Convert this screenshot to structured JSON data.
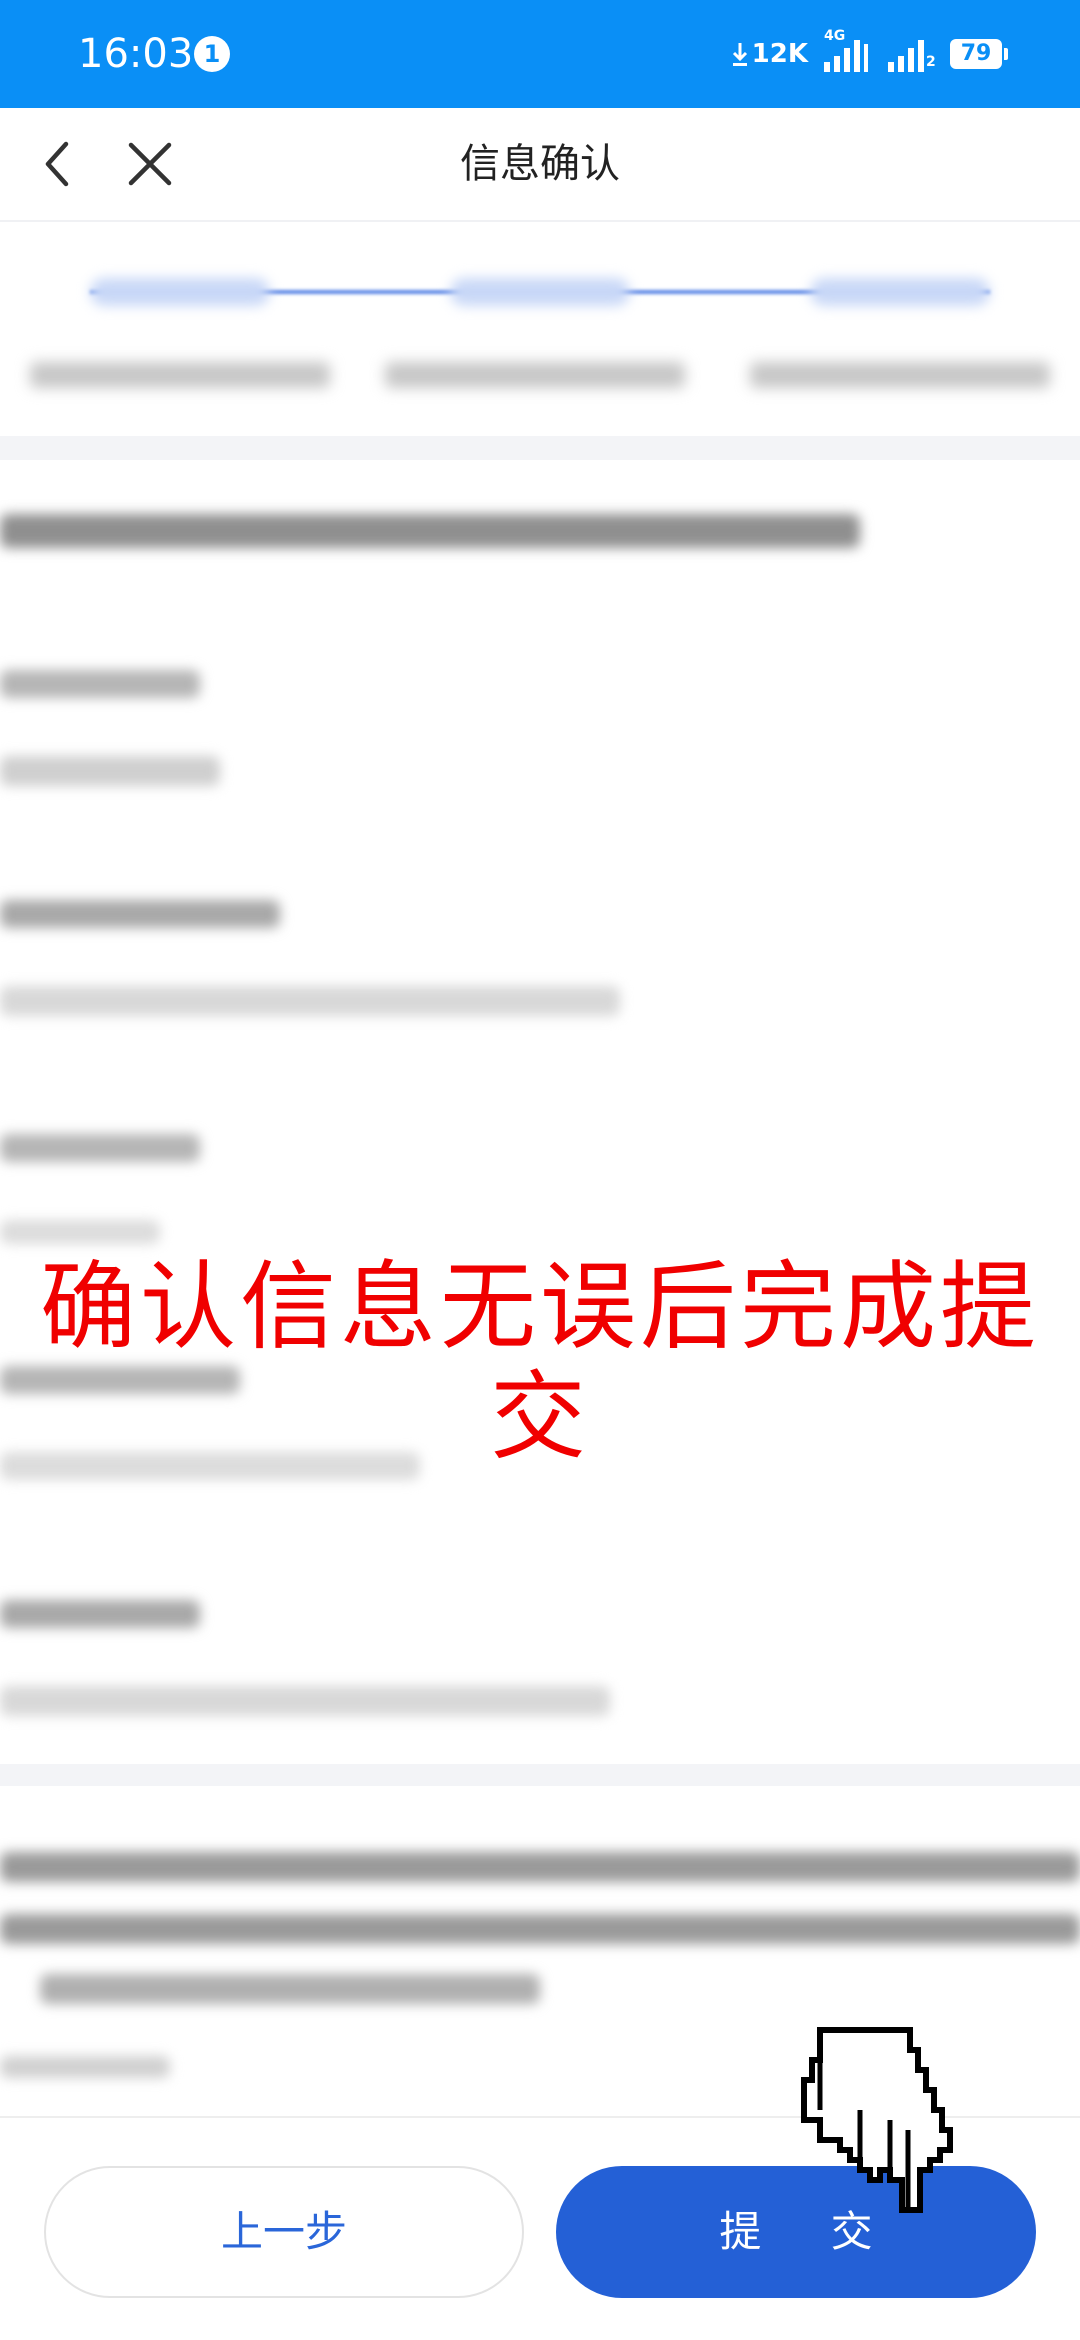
{
  "status_bar": {
    "time": "16:03",
    "notification_count": "1",
    "net_speed": "12K",
    "network_type": "4G",
    "sim2_label": "2",
    "battery": "79",
    "background": "#0a8ff6"
  },
  "header": {
    "title": "信息确认"
  },
  "overlay": {
    "annotation": "确认信息无误后完成提交",
    "color": "#f00000"
  },
  "footer": {
    "prev_label": "上一步",
    "submit_label": "提 交",
    "accent": "#2460d6"
  },
  "icons": {
    "back": "chevron-left-icon",
    "close": "close-icon",
    "pointer": "hand-pointer-icon"
  }
}
